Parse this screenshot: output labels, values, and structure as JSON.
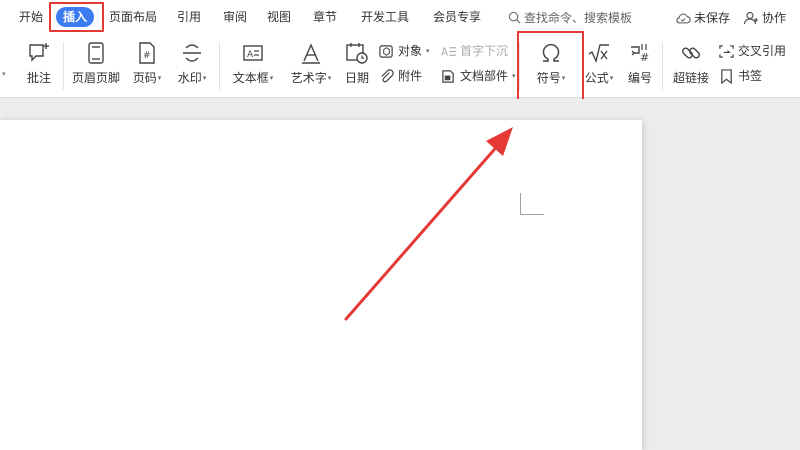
{
  "menu": {
    "tabs": [
      "开始",
      "插入",
      "页面布局",
      "引用",
      "审阅",
      "视图",
      "章节",
      "开发工具",
      "会员专享"
    ],
    "active_tab": "插入",
    "search_placeholder": "查找命令、搜索模板",
    "unsaved": "未保存",
    "collaborate": "协作"
  },
  "ribbon": {
    "comment": "批注",
    "header_footer": "页眉页脚",
    "page_number": "页码",
    "watermark": "水印",
    "textbox": "文本框",
    "wordart": "艺术字",
    "date": "日期",
    "object": "对象",
    "attachment": "附件",
    "drop_cap": "首字下沉",
    "doc_parts": "文档部件",
    "symbol": "符号",
    "formula": "公式",
    "numbering": "编号",
    "hyperlink": "超链接",
    "cross_reference": "交叉引用",
    "bookmark": "书签"
  },
  "colors": {
    "accent": "#3c7cf2",
    "highlight_red": "#e53935"
  }
}
